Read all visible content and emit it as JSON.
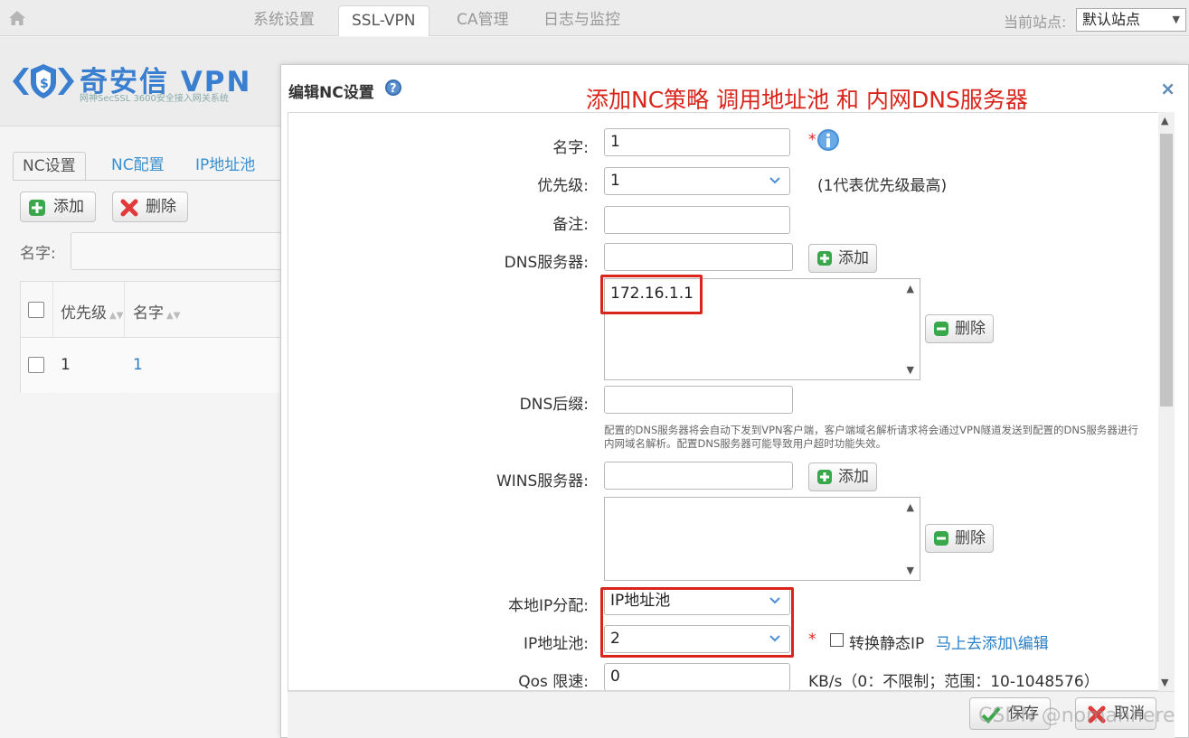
{
  "topnav": {
    "tabs": [
      "系统设置",
      "SSL-VPN",
      "CA管理",
      "日志与监控"
    ],
    "active_tab": "SSL-VPN",
    "site_label": "当前站点:",
    "site_value": "默认站点"
  },
  "logo": {
    "title": "奇安信 VPN",
    "subtitle": "网神SecSSL 3600安全接入网关系统"
  },
  "left": {
    "tabs": [
      "NC设置",
      "NC配置",
      "IP地址池"
    ],
    "add_button": "添加",
    "delete_button": "删除",
    "name_label": "名字:",
    "table": {
      "columns": [
        "优先级",
        "名字"
      ],
      "rows": [
        {
          "priority": "1",
          "name": "1"
        }
      ]
    }
  },
  "dialog": {
    "title": "编辑NC设置",
    "annotation": "添加NC策略 调用地址池  和 内网DNS服务器",
    "fields": {
      "name_label": "名字:",
      "name_value": "1",
      "priority_label": "优先级:",
      "priority_value": "1",
      "priority_note": "(1代表优先级最高)",
      "remark_label": "备注:",
      "remark_value": "",
      "dns_label": "DNS服务器:",
      "dns_input": "",
      "dns_list": [
        "172.16.1.1"
      ],
      "dns_add": "添加",
      "dns_delete": "删除",
      "dns_suffix_label": "DNS后缀:",
      "dns_suffix_value": "",
      "dns_hint": "配置的DNS服务器将会自动下发到VPN客户端，客户端域名解析请求将会通过VPN隧道发送到配置的DNS服务器进行内网域名解析。配置DNS服务器可能导致用户超时功能失效。",
      "wins_label": "WINS服务器:",
      "wins_input": "",
      "wins_add": "添加",
      "wins_delete": "删除",
      "local_ip_label": "本地IP分配:",
      "local_ip_value": "IP地址池",
      "ip_pool_label": "IP地址池:",
      "ip_pool_value": "2",
      "static_ip_label": "转换静态IP",
      "quick_add_link": "马上去添加\\编辑",
      "qos_label": "Qos 限速:",
      "qos_value": "0",
      "qos_note": "KB/s（0：不限制；范围：10-1048576）"
    },
    "save_button": "保存",
    "cancel_button": "取消"
  },
  "watermark": "CSDN @nomanhere"
}
